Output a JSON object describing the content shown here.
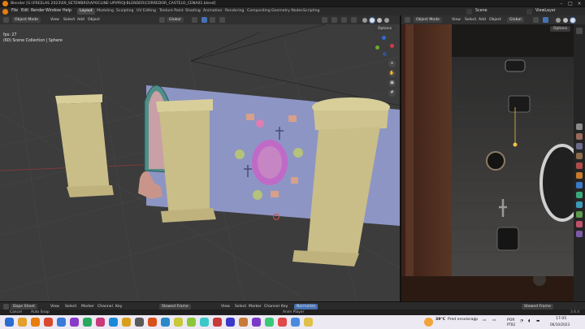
{
  "titlebar": {
    "title": "Blender [G:\\FREELAS 2023\\09_SETEMBRO\\APOCLINE-UP\\PROJ-BLENDER\\CORREDOR_CASTELO_CENA01.blend]"
  },
  "menus": [
    "File",
    "Edit",
    "Render",
    "Window",
    "Help"
  ],
  "workspaces": [
    "Layout",
    "Modeling",
    "Sculpting",
    "UV Editing",
    "Texture Paint",
    "Shading",
    "Animation",
    "Rendering",
    "Compositing",
    "Geometry Nodes",
    "Scripting"
  ],
  "active_workspace": "Layout",
  "scene": {
    "label": "Scene",
    "view_layer": "ViewLayer"
  },
  "left_header": {
    "mode": "Object Mode",
    "links": [
      "View",
      "Select",
      "Add",
      "Object"
    ],
    "orientation": "Global",
    "options": "Options"
  },
  "right_header": {
    "mode": "Object Mode",
    "links": [
      "View",
      "Select",
      "Add",
      "Object"
    ],
    "orientation": "Global",
    "options": "Options"
  },
  "viewport_left": {
    "line1": "fps: 27",
    "line2": "(60) Scene Collection | Sphere",
    "plane_color": "#8d95c4"
  },
  "timeline": {
    "left_mode": "Dope Sheet",
    "left_links": [
      "View",
      "Select",
      "Marker",
      "Channel",
      "Key"
    ],
    "left_keying": "Summary",
    "left_frames": "Stowed Frame",
    "right_links": [
      "View",
      "Select",
      "Marker",
      "Channel",
      "Key"
    ],
    "right_normalize": "Normalize",
    "right_frames": "Stowed Frame"
  },
  "statusbar": {
    "left1": "Cancel",
    "left2": "Auto Snap",
    "center": "Anim Player",
    "version": "3.6.4"
  },
  "taskbar": {
    "weather_temp": "39°C",
    "weather_desc": "Pred ensolarado",
    "lang": "POR",
    "lang2": "PTB2",
    "time": "17:05",
    "date": "06/10/2023"
  },
  "colors": {
    "accent": "#4772b3",
    "pillar": "#c9bd88",
    "plane": "#8d95c4",
    "orange": "#e87d0d"
  }
}
